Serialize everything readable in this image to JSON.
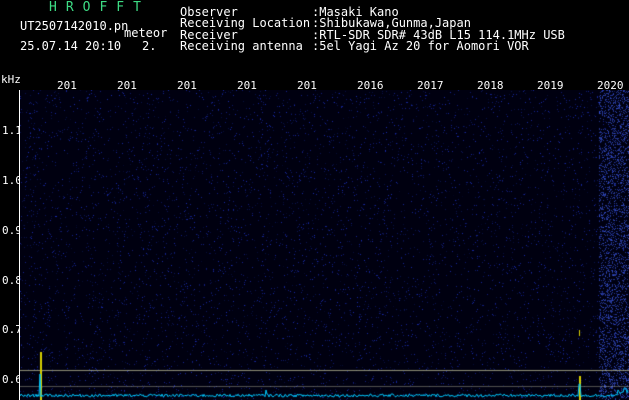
{
  "header": {
    "brand": "HROFFT",
    "filename": "UT2507142010.pn",
    "tag": "meteor",
    "datetime": "25.07.14 20:10",
    "count": "2.",
    "fields": [
      {
        "label": "Observer",
        "value": ":Masaki Kano"
      },
      {
        "label": "Receiving Location",
        "value": ":Shibukawa,Gunma,Japan"
      },
      {
        "label": "Receiver",
        "value": ":RTL-SDR SDR# 43dB L15 114.1MHz USB"
      },
      {
        "label": "Receiving antenna",
        "value": ":5el Yagi Az 20 for Aomori VOR"
      }
    ]
  },
  "plot": {
    "y_unit": "kHz",
    "y_ticks": [
      "1.1",
      "1.0",
      "0.9",
      "0.8",
      "0.7",
      "0.6"
    ],
    "x_ticks": [
      "201",
      "201",
      "201",
      "201",
      "201",
      "2016",
      "2017",
      "2018",
      "2019",
      "2020"
    ],
    "colors": {
      "background": "#000010",
      "noise": "#1a2a9a",
      "trace": "#00c8ff",
      "marker": "#d8d000"
    }
  }
}
